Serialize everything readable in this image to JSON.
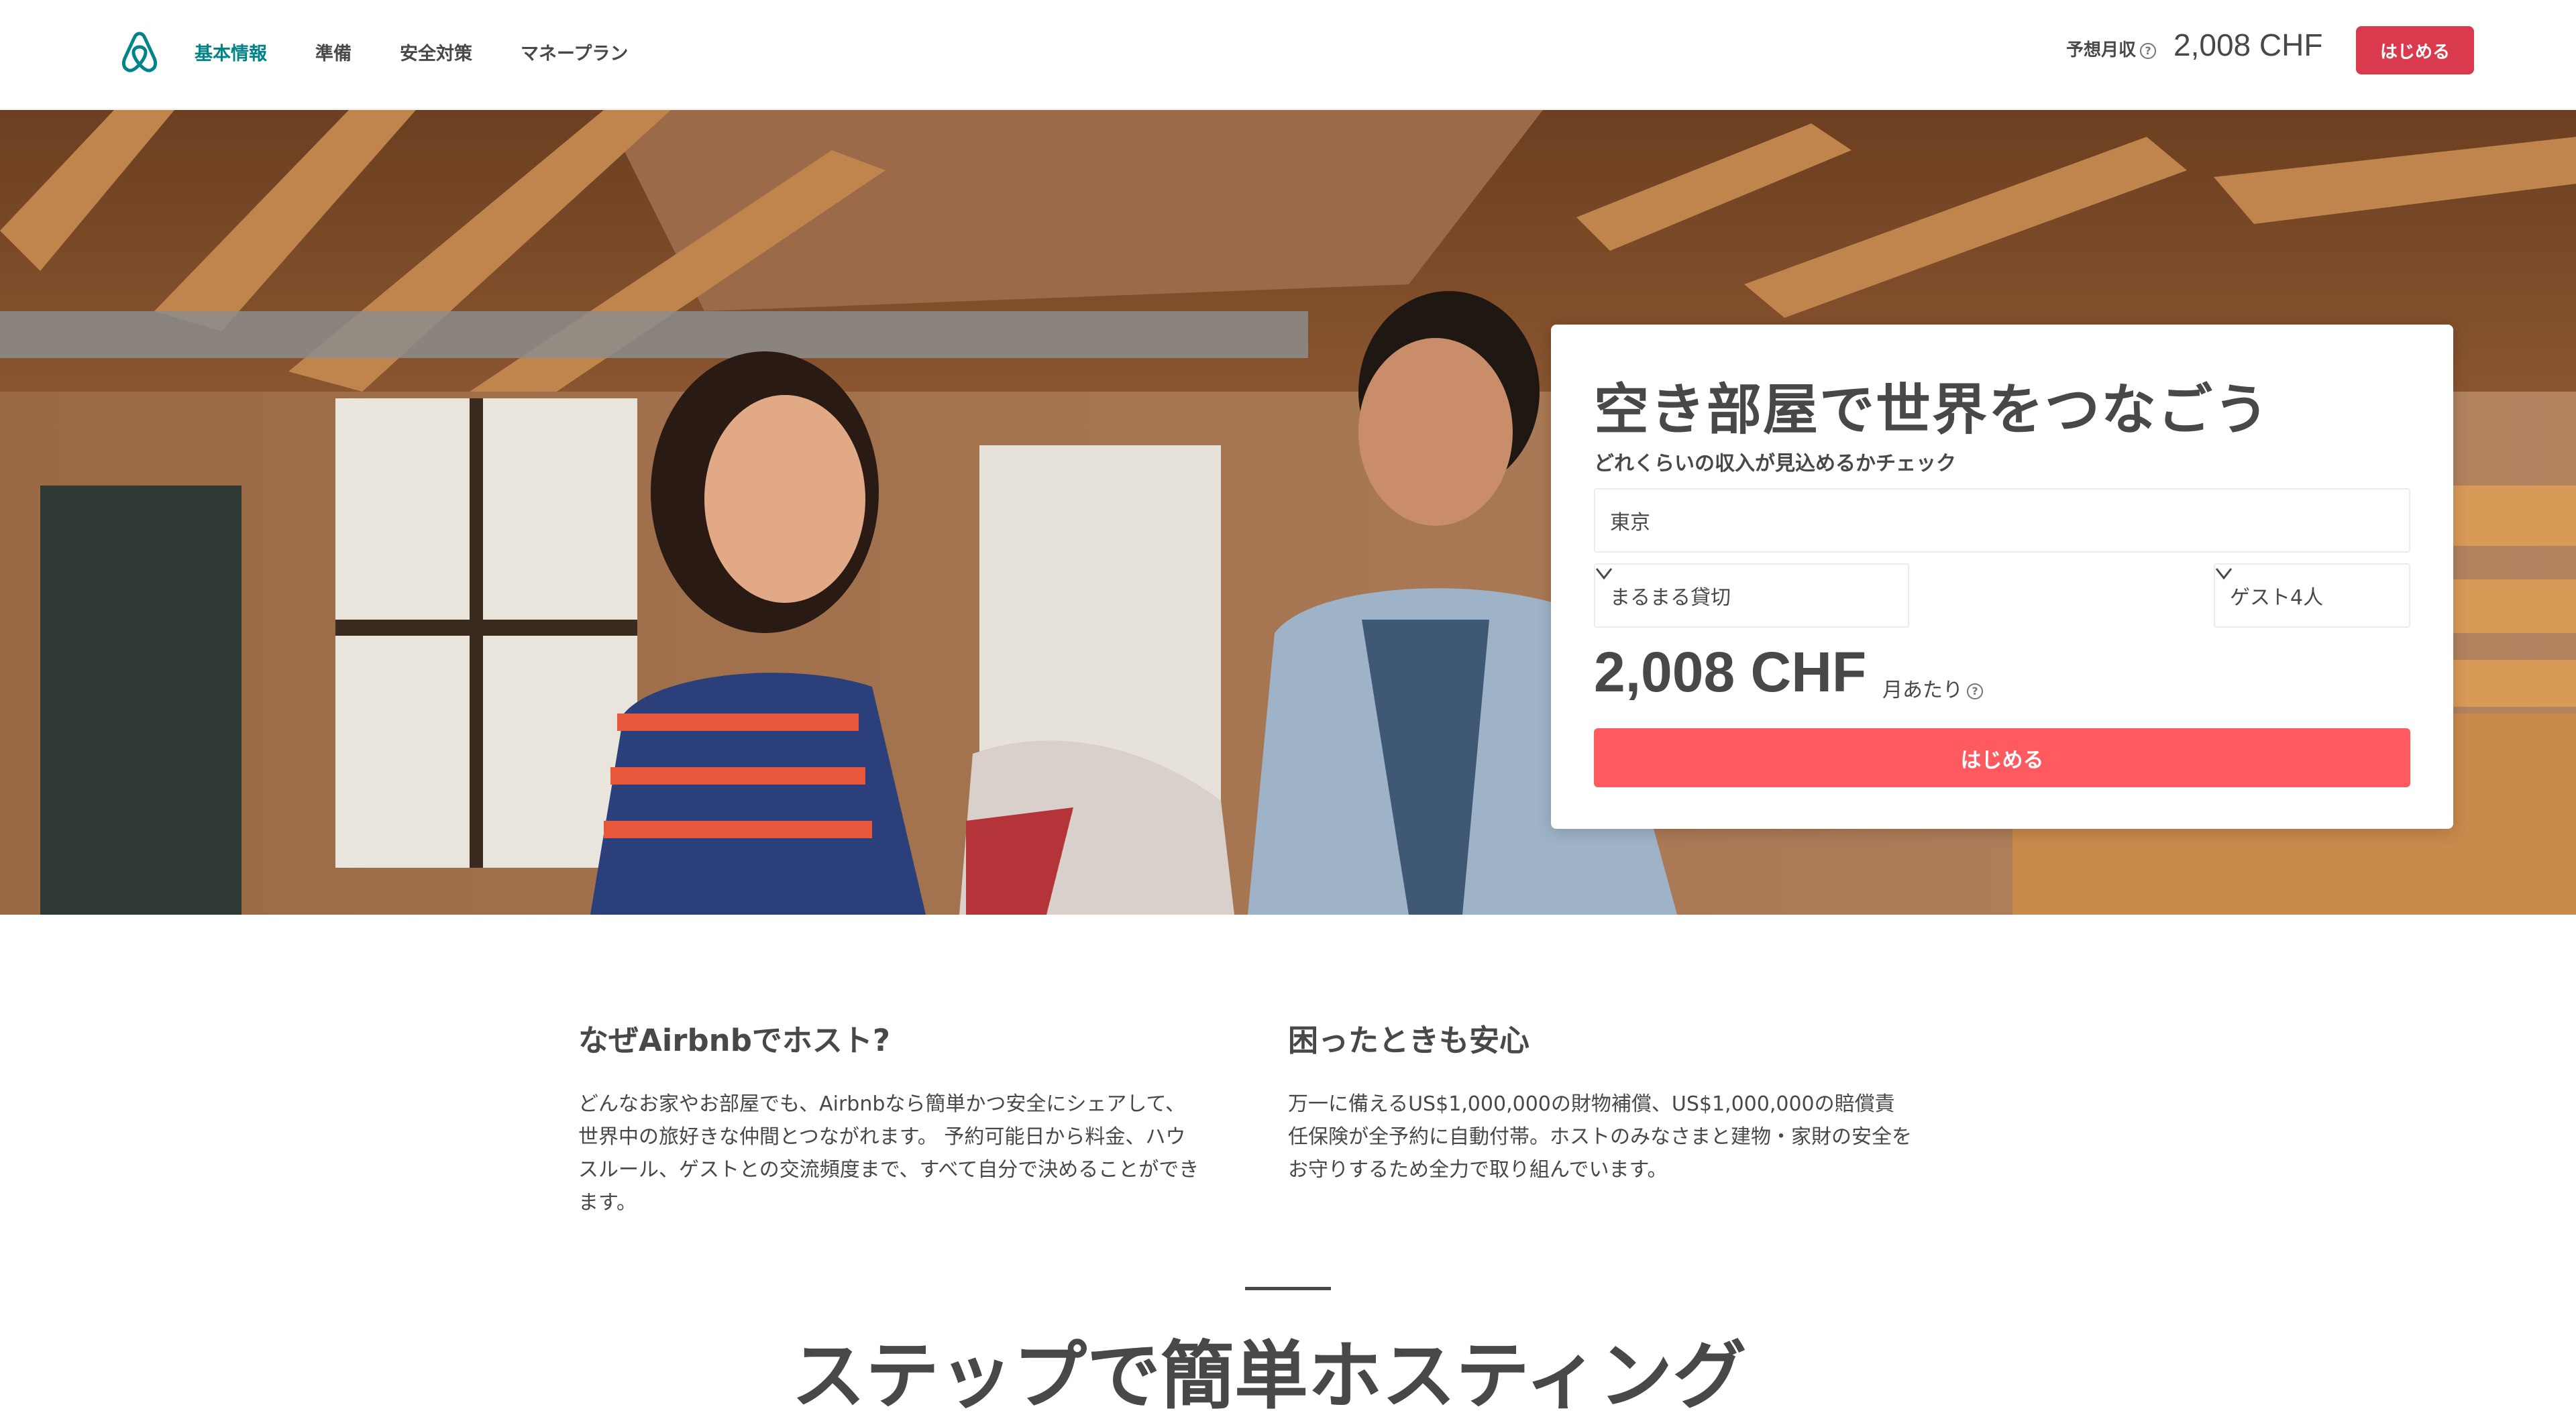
{
  "header": {
    "logo": "airbnb-logo",
    "nav": [
      {
        "label": "基本情報",
        "active": true
      },
      {
        "label": "準備",
        "active": false
      },
      {
        "label": "安全対策",
        "active": false
      },
      {
        "label": "マネープラン",
        "active": false
      }
    ],
    "earnings_label": "予想月収",
    "earnings_help_icon": "question-circle-icon",
    "earnings_value": "2,008 CHF",
    "start_button": "はじめる"
  },
  "hero": {
    "image": "hosts-in-loft-photo"
  },
  "estimate_card": {
    "title": "空き部屋で世界をつなごう",
    "subtitle": "どれくらいの収入が見込めるかチェック",
    "city_value": "東京",
    "room_type": "まるまる貸切",
    "guests": "ゲスト4人",
    "price": "2,008 CHF",
    "per_month": "月あたり",
    "start_button": "はじめる"
  },
  "info": {
    "left": {
      "heading": "なぜAirbnbでホスト?",
      "body": "どんなお家やお部屋でも、Airbnbなら簡単かつ安全にシェアして、世界中の旅好きな仲間とつながれます。 予約可能日から料金、ハウスルール、ゲストとの交流頻度まで、すべて自分で決めることができます。"
    },
    "right": {
      "heading": "困ったときも安心",
      "body": "万一に備えるUS$1,000,000の財物補償、US$1,000,000の賠償責任保険が全予約に自動付帯。ホストのみなさまと建物・家財の安全をお守りするため全力で取り組んでいます。"
    }
  },
  "next_section": {
    "heading": "ステップで簡単ホスティング"
  },
  "colors": {
    "brand": "#ff5a5f",
    "brand_dark": "#d93a4e",
    "nav_active": "#008489",
    "text": "#484848"
  }
}
